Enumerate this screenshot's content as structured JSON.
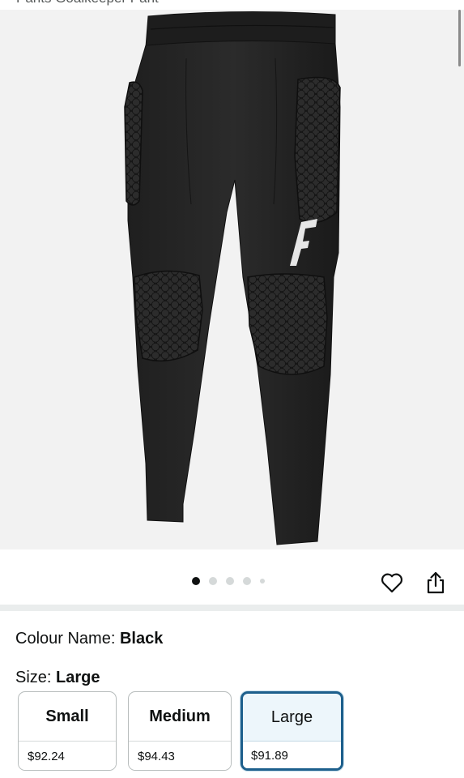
{
  "header": {
    "title_fragment": "Pants Goalkeeper Pant"
  },
  "gallery": {
    "image_alt": "Black goalkeeper pants with hexagonal padding",
    "dot_count": 5,
    "active_index": 0,
    "wishlist_icon": "heart-icon",
    "share_icon": "share-icon"
  },
  "product": {
    "colour_label": "Colour Name:",
    "colour_value": "Black",
    "size_label": "Size:",
    "size_value": "Large"
  },
  "sizes": [
    {
      "name": "Small",
      "price": "$92.24",
      "selected": false
    },
    {
      "name": "Medium",
      "price": "$94.43",
      "selected": false
    },
    {
      "name": "Large",
      "price": "$91.89",
      "selected": true
    }
  ],
  "colors": {
    "selected_border": "#1d5f8c",
    "selected_bg": "#edf6fb",
    "image_bg": "#f2f2f2"
  }
}
